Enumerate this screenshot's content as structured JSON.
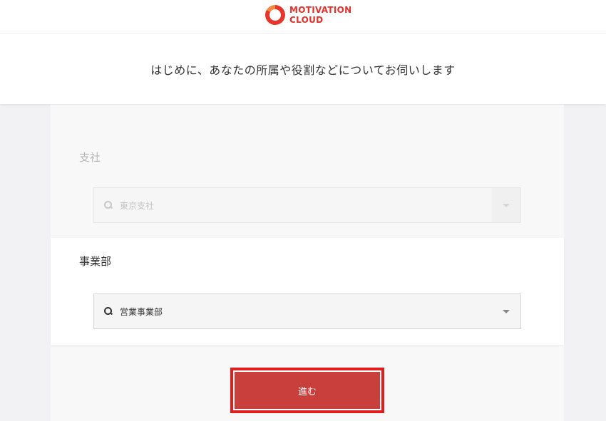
{
  "header": {
    "logo_line1": "MOTIVATION",
    "logo_line2": "CLOUD",
    "brand_color": "#e0312a"
  },
  "intro": {
    "text": "はじめに、あなたの所属や役割などについてお伺いします"
  },
  "branch": {
    "label": "支社",
    "selected_value": "東京支社",
    "state": "disabled"
  },
  "division": {
    "label": "事業部",
    "selected_value": "営業事業部"
  },
  "actions": {
    "proceed_label": "進む",
    "button_color": "#c93f3c",
    "focus_outline_color": "#e11d1d"
  },
  "icons": {
    "search": "search-icon",
    "dropdown": "chevron-down-icon",
    "logo": "logo-ring-icon"
  }
}
